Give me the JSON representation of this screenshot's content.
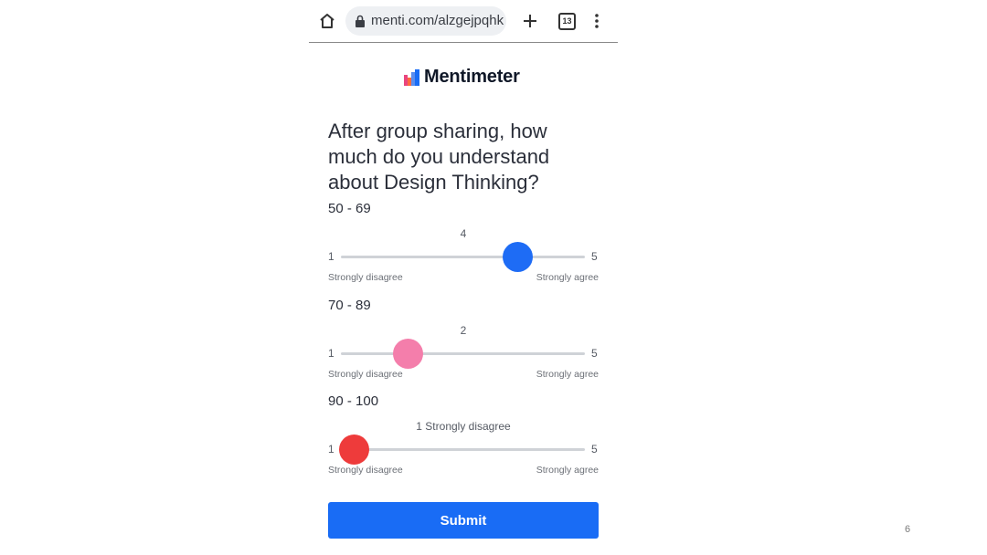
{
  "browser": {
    "url": "menti.com/alzgejpqhk",
    "tab_count": "13",
    "icons": {
      "home": "home-icon",
      "lock": "lock-icon",
      "new_tab": "plus-icon",
      "tabs": "tabs-icon",
      "menu": "more-vert-icon"
    }
  },
  "brand": {
    "name": "Mentimeter",
    "logo_colors": [
      "#e9467e",
      "#ff6a3d",
      "#5a8dee",
      "#196cf5"
    ]
  },
  "question": "After group sharing, how much do you understand about Design Thinking?",
  "scales": [
    {
      "label": "50 - 69",
      "value": 4,
      "value_label": "4",
      "min": "1",
      "max": "5",
      "min_label": "Strongly disagree",
      "max_label": "Strongly agree",
      "color": "#1e6cf5"
    },
    {
      "label": "70 - 89",
      "value": 2,
      "value_label": "2",
      "min": "1",
      "max": "5",
      "min_label": "Strongly disagree",
      "max_label": "Strongly agree",
      "color": "#f47eab"
    },
    {
      "label": "90 - 100",
      "value": 1,
      "value_label": "1  Strongly disagree",
      "min": "1",
      "max": "5",
      "min_label": "Strongly disagree",
      "max_label": "Strongly agree",
      "color": "#ee3b3b"
    }
  ],
  "submit_label": "Submit",
  "submit_color": "#196cf5",
  "slide_number": "6"
}
